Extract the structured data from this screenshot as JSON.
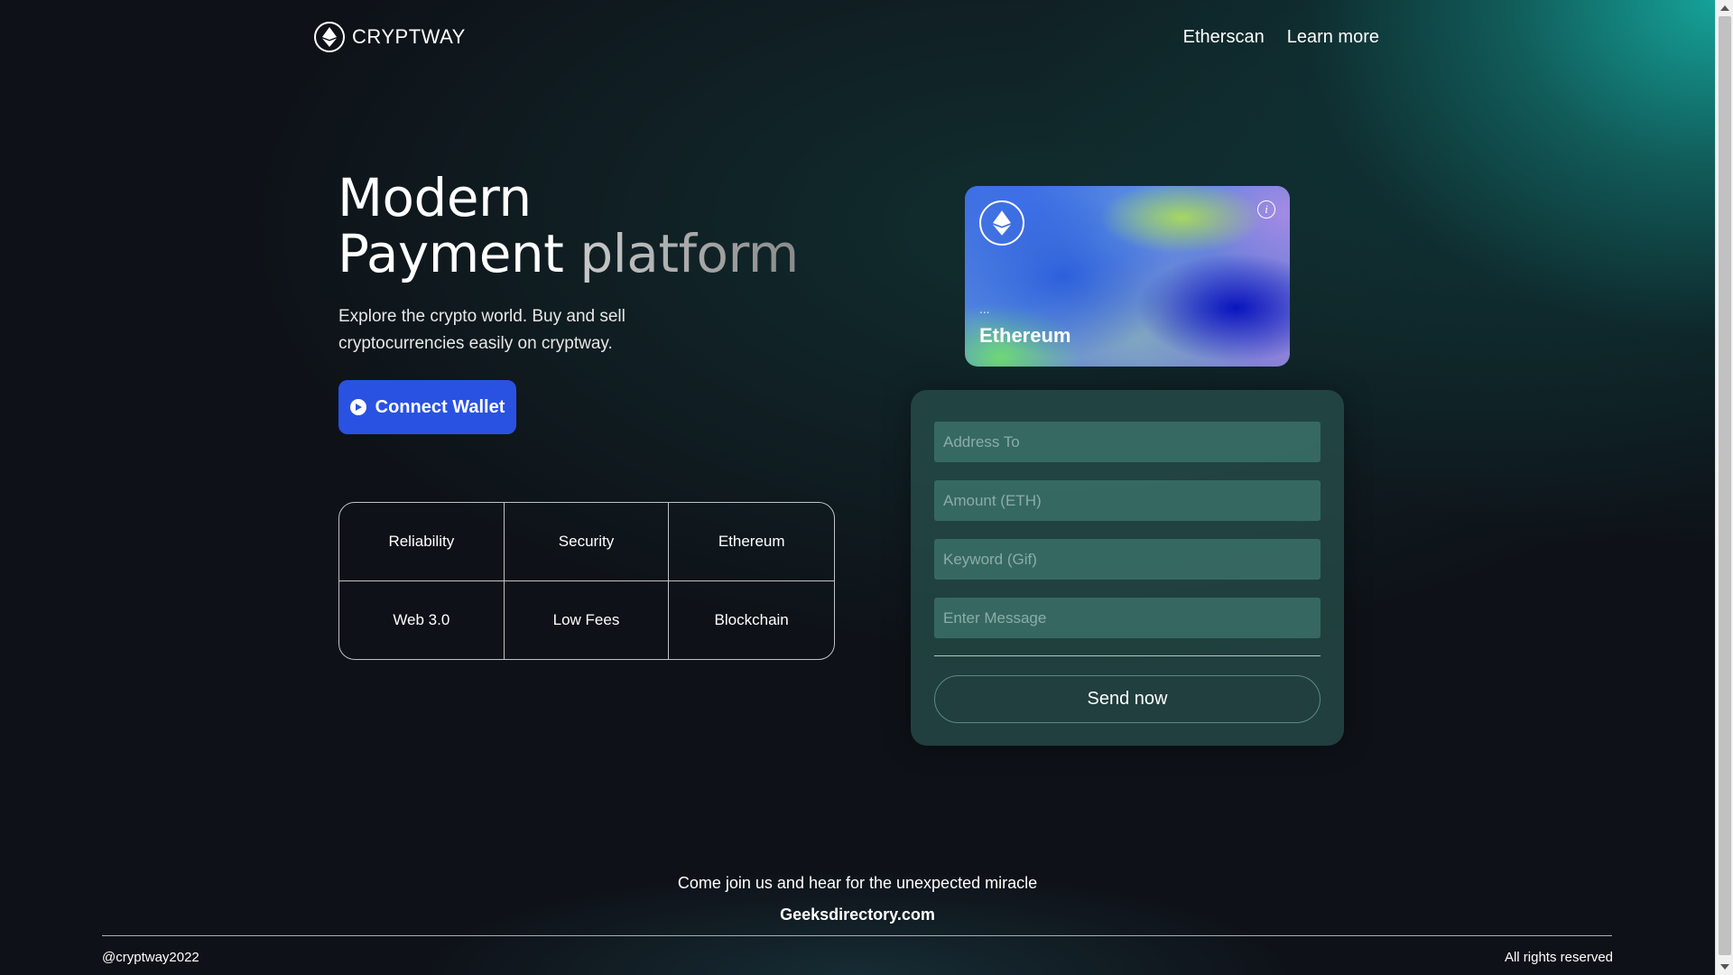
{
  "nav": {
    "brand": "CRYPTWAY",
    "brand_icon": "ethereum-icon",
    "links": [
      "Etherscan",
      "Learn more"
    ]
  },
  "hero": {
    "title_line1": "Modern",
    "title_line2_a": "Payment",
    "title_line2_b": "platform",
    "subtitle": "Explore the crypto world. Buy and sell cryptocurrencies easily on cryptway.",
    "connect_label": "Connect Wallet",
    "connect_color": "#2952e3"
  },
  "features": [
    "Reliability",
    "Security",
    "Ethereum",
    "Web 3.0",
    "Low Fees",
    "Blockchain"
  ],
  "card": {
    "address": "...",
    "chain": "Ethereum",
    "logo_icon": "ethereum-icon",
    "info_icon": "info-icon"
  },
  "form": {
    "address_placeholder": "Address To",
    "amount_placeholder": "Amount (ETH)",
    "keyword_placeholder": "Keyword (Gif)",
    "message_placeholder": "Enter Message",
    "send_label": "Send now"
  },
  "footer": {
    "tagline": "Come join us and hear for the unexpected miracle",
    "site": "Geeksdirectory.com",
    "handle": "@cryptway2022",
    "rights": "All rights reserved"
  }
}
